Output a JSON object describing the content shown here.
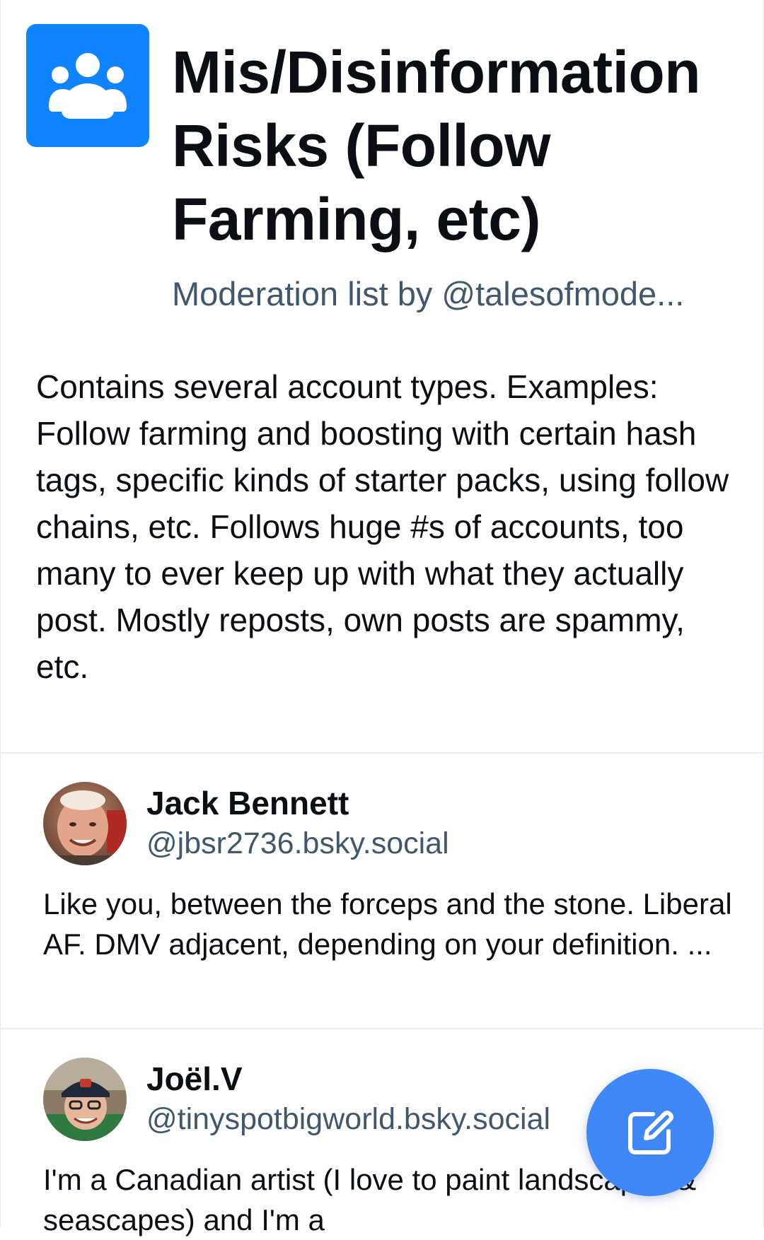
{
  "list": {
    "title": "Mis/Disinformation Risks (Follow Farming, etc)",
    "byline": "Moderation list by @talesofmode...",
    "description": "Contains several account types. Examples: Follow farming and boosting with certain hash tags, specific kinds of starter packs, using follow chains, etc. Follows huge #s of accounts, too many to ever keep up with what they actually post. Mostly reposts, own posts are spammy, etc.",
    "icon": "people-group-icon",
    "accent_color": "#1083fe"
  },
  "members": [
    {
      "name": "Jack Bennett",
      "handle": "@jbsr2736.bsky.social",
      "bio": "Like you, between the forceps and the stone. Liberal AF. DMV adjacent, depending on your definition. ..."
    },
    {
      "name": "Joël.V",
      "handle": "@tinyspotbigworld.bsky.social",
      "bio": "I'm a Canadian artist (I love to paint landscapes & seascapes) and I'm a"
    }
  ],
  "fab": {
    "icon": "compose-icon",
    "color": "#3f86f7"
  }
}
